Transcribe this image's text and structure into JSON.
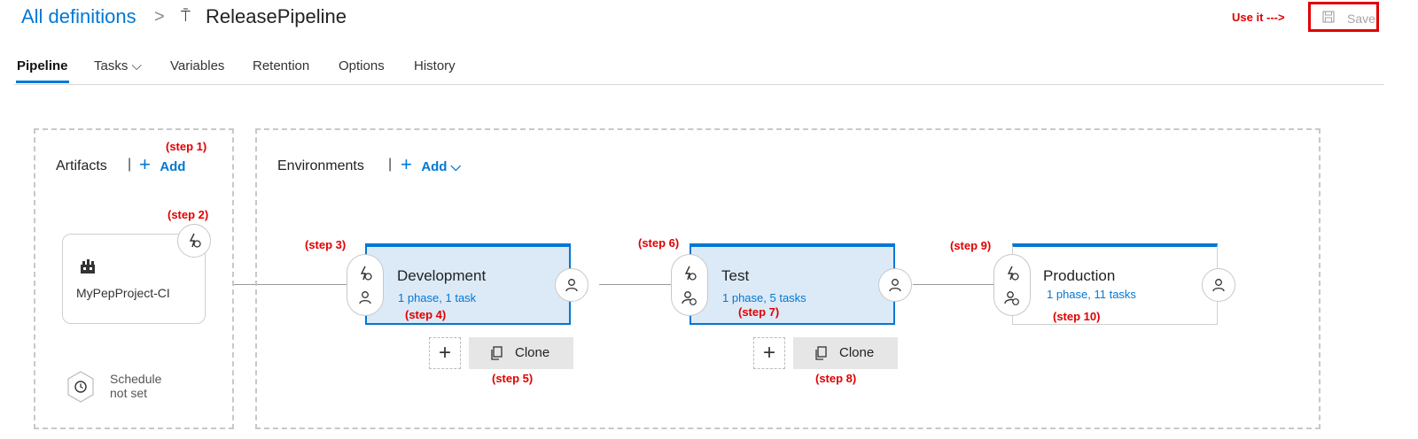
{
  "header": {
    "breadcrumb_root": "All definitions",
    "breadcrumb_separator": ">",
    "title": "ReleasePipeline",
    "annotation": "Use it --->",
    "save_label": "Save"
  },
  "tabs": [
    {
      "label": "Pipeline",
      "active": true
    },
    {
      "label": "Tasks ⌵",
      "active": false
    },
    {
      "label": "Variables",
      "active": false
    },
    {
      "label": "Retention",
      "active": false
    },
    {
      "label": "Options",
      "active": false
    },
    {
      "label": "History",
      "active": false
    }
  ],
  "artifacts": {
    "title": "Artifacts",
    "add_label": "Add",
    "artifact_name": "MyPepProject-CI",
    "schedule_line1": "Schedule",
    "schedule_line2": "not set"
  },
  "environments": {
    "title": "Environments",
    "add_label": "Add ⌵",
    "items": [
      {
        "name": "Development",
        "summary": "1 phase, 1 task"
      },
      {
        "name": "Test",
        "summary": "1 phase, 5 tasks"
      },
      {
        "name": "Production",
        "summary": "1 phase, 11 tasks"
      }
    ],
    "clone_label": "Clone"
  },
  "steps": {
    "s1": "(step 1)",
    "s2": "(step 2)",
    "s3": "(step 3)",
    "s4": "(step 4)",
    "s5": "(step 5)",
    "s6": "(step 6)",
    "s7": "(step 7)",
    "s8": "(step 8)",
    "s9": "(step 9)",
    "s10": "(step 10)"
  },
  "colors": {
    "accent": "#0078d4",
    "annotation": "#e00000",
    "selected_bg": "#dceaf7"
  },
  "icons": [
    "pipeline-icon",
    "save-icon",
    "plus-icon",
    "build-icon",
    "trigger-icon",
    "person-icon",
    "clock-icon",
    "clone-icon"
  ]
}
